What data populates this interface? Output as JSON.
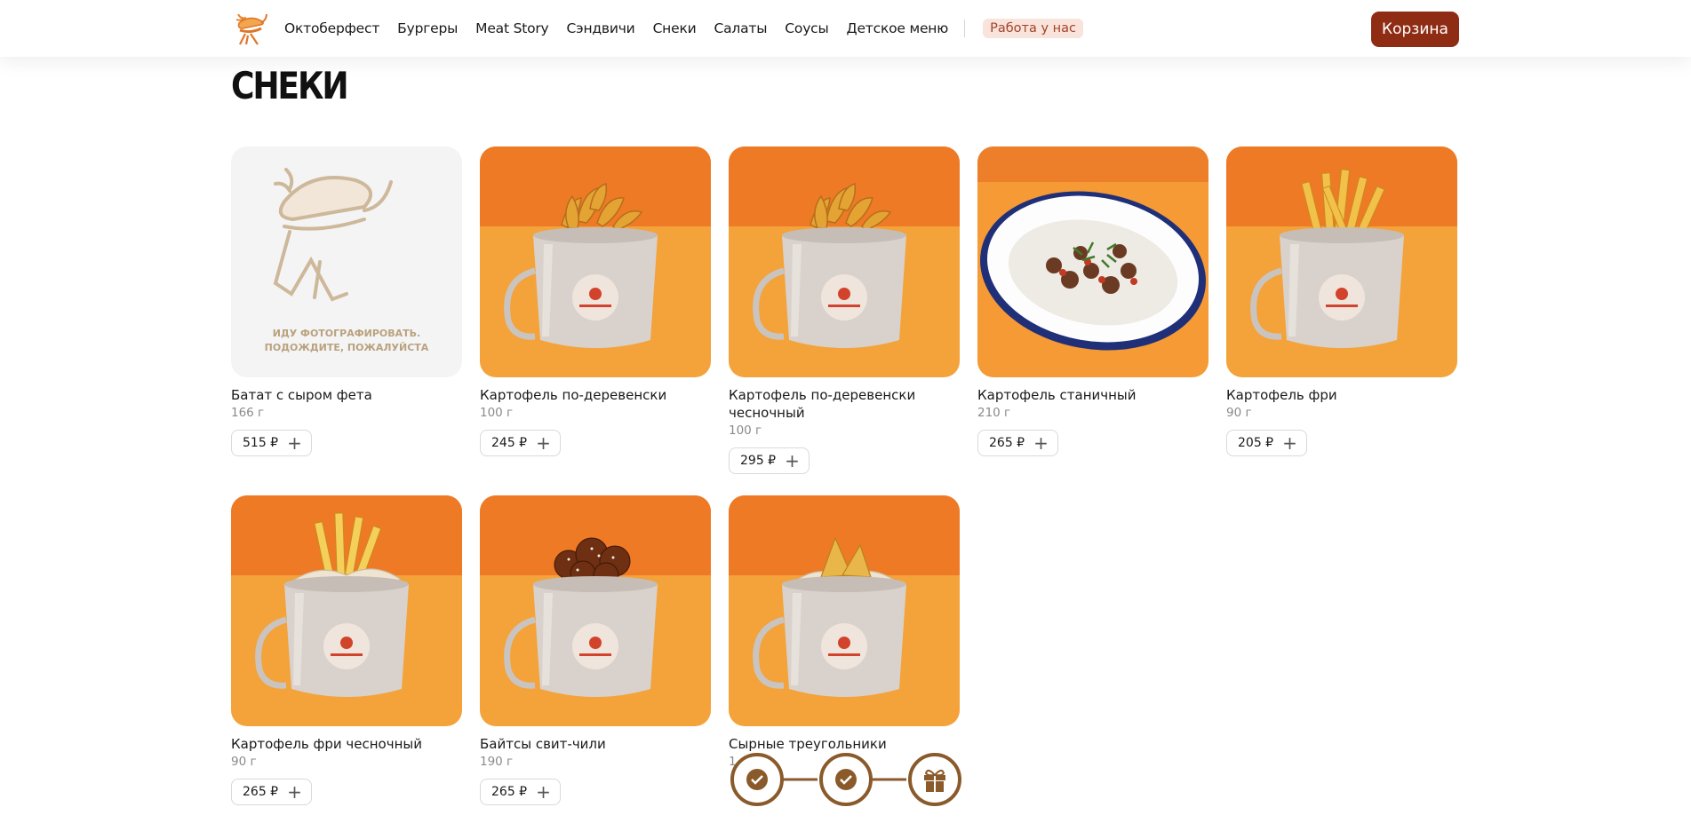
{
  "header": {
    "nav": [
      "Октоберфест",
      "Бургеры",
      "Meat Story",
      "Сэндвичи",
      "Снеки",
      "Салаты",
      "Соусы",
      "Детское меню"
    ],
    "jobs_label": "Работа у нас",
    "cart_label": "Корзина"
  },
  "page_title": "СНЕКИ",
  "placeholder_text": [
    "ИДУ ФОТОГРАФИРОВАТЬ.",
    "ПОДОЖДИТЕ, ПОЖАЛУЙСТА"
  ],
  "products": [
    {
      "name": "Батат с сыром фета",
      "weight": "166 г",
      "price": "515 ₽",
      "photo": "placeholder-mascot"
    },
    {
      "name": "Картофель по-деревенски",
      "weight": "100 г",
      "price": "245 ₽",
      "photo": "mug-wedges"
    },
    {
      "name": "Картофель по-деревенски чесночный",
      "weight": "100 г",
      "price": "295 ₽",
      "photo": "mug-wedges"
    },
    {
      "name": "Картофель станичный",
      "weight": "210 г",
      "price": "265 ₽",
      "photo": "plate-potatoes"
    },
    {
      "name": "Картофель фри",
      "weight": "90 г",
      "price": "205 ₽",
      "photo": "mug-fries"
    },
    {
      "name": "Картофель фри чесночный",
      "weight": "90 г",
      "price": "265 ₽",
      "photo": "mug-fries-paper"
    },
    {
      "name": "Байтсы свит-чили",
      "weight": "190 г",
      "price": "265 ₽",
      "photo": "mug-bites"
    },
    {
      "name": "Сырные треугольники",
      "weight": "1",
      "price": "",
      "photo": "mug-cheese"
    }
  ],
  "colors": {
    "accent": "#8f2c14",
    "orange": "#f58a2e",
    "progress": "#8a5a2b"
  },
  "icons": {
    "plus": "plus-icon",
    "check": "check-icon",
    "gift": "gift-icon"
  }
}
